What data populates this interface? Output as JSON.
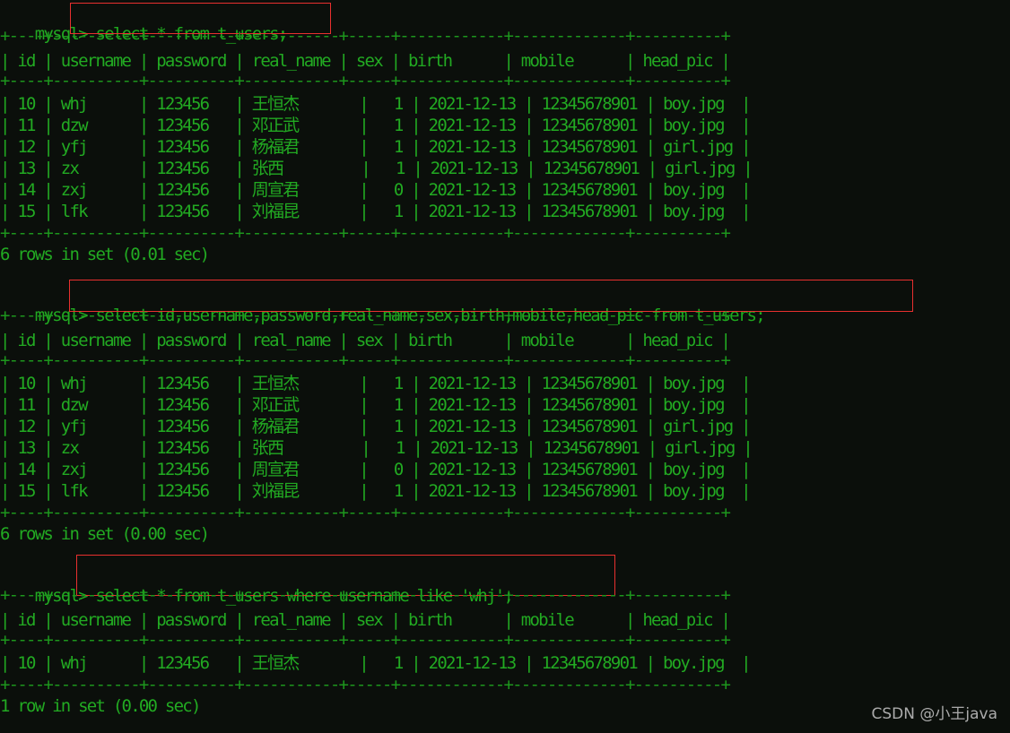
{
  "terminal": {
    "prompt": "mysql>",
    "colors": {
      "background": "#0b0f0b",
      "text_green": "#22aa22",
      "rule_green": "#1d961d",
      "highlight_red": "#e8302f",
      "watermark_gray": "#b9b9b9"
    }
  },
  "watermark": {
    "text": "CSDN @小王java"
  },
  "table": {
    "headers": [
      "id",
      "username",
      "password",
      "real_name",
      "sex",
      "birth",
      "mobile",
      "head_pic"
    ],
    "separator": "+----+----------+----------+-----------+-----+------------+-------------+----------+",
    "rows": [
      {
        "id": "10",
        "username": "whj",
        "password": "123456",
        "real_name": "王恒杰",
        "sex": "1",
        "birth": "2021-12-13",
        "mobile": "12345678901",
        "head_pic": "boy.jpg"
      },
      {
        "id": "11",
        "username": "dzw",
        "password": "123456",
        "real_name": "邓正武",
        "sex": "1",
        "birth": "2021-12-13",
        "mobile": "12345678901",
        "head_pic": "boy.jpg"
      },
      {
        "id": "12",
        "username": "yfj",
        "password": "123456",
        "real_name": "杨福君",
        "sex": "1",
        "birth": "2021-12-13",
        "mobile": "12345678901",
        "head_pic": "girl.jpg"
      },
      {
        "id": "13",
        "username": "zx",
        "password": "123456",
        "real_name": "张西",
        "sex": "1",
        "birth": "2021-12-13",
        "mobile": "12345678901",
        "head_pic": "girl.jpg"
      },
      {
        "id": "14",
        "username": "zxj",
        "password": "123456",
        "real_name": "周宣君",
        "sex": "0",
        "birth": "2021-12-13",
        "mobile": "12345678901",
        "head_pic": "boy.jpg"
      },
      {
        "id": "15",
        "username": "lfk",
        "password": "123456",
        "real_name": "刘福昆",
        "sex": "1",
        "birth": "2021-12-13",
        "mobile": "12345678901",
        "head_pic": "boy.jpg"
      }
    ]
  },
  "queries": [
    {
      "id": "query-1",
      "sql": "select * from t_users;",
      "result_status": "6 rows in set (0.01 sec)",
      "row_count": 6
    },
    {
      "id": "query-2",
      "sql": "select id,username,password,real_name,sex,birth,mobile,head_pic from t_users;",
      "result_status": "6 rows in set (0.00 sec)",
      "row_count": 6
    },
    {
      "id": "query-3",
      "sql": "select * from t_users where username like 'whj';",
      "result_status": "1 row in set (0.00 sec)",
      "row_count": 1
    }
  ],
  "blocks": {
    "b1_sep_top": "+----+----------+----------+-----------+-----+------------+-------------+----------+",
    "b1_header": "| id | username | password | real_name | sex | birth      | mobile      | head_pic |",
    "b1_sep_mid": "+----+----------+----------+-----------+-----+------------+-------------+----------+",
    "b1_r1": "| 10 | whj      | 123456   | 王恒杰       |   1 | 2021-12-13 | 12345678901 | boy.jpg  |",
    "b1_r2": "| 11 | dzw      | 123456   | 邓正武       |   1 | 2021-12-13 | 12345678901 | boy.jpg  |",
    "b1_r3": "| 12 | yfj      | 123456   | 杨福君       |   1 | 2021-12-13 | 12345678901 | girl.jpg |",
    "b1_r4": "| 13 | zx       | 123456   | 张西         |   1 | 2021-12-13 | 12345678901 | girl.jpg |",
    "b1_r5": "| 14 | zxj      | 123456   | 周宣君       |   0 | 2021-12-13 | 12345678901 | boy.jpg  |",
    "b1_r6": "| 15 | lfk      | 123456   | 刘福昆       |   1 | 2021-12-13 | 12345678901 | boy.jpg  |",
    "b1_sep_bot": "+----+----------+----------+-----------+-----+------------+-------------+----------+"
  }
}
